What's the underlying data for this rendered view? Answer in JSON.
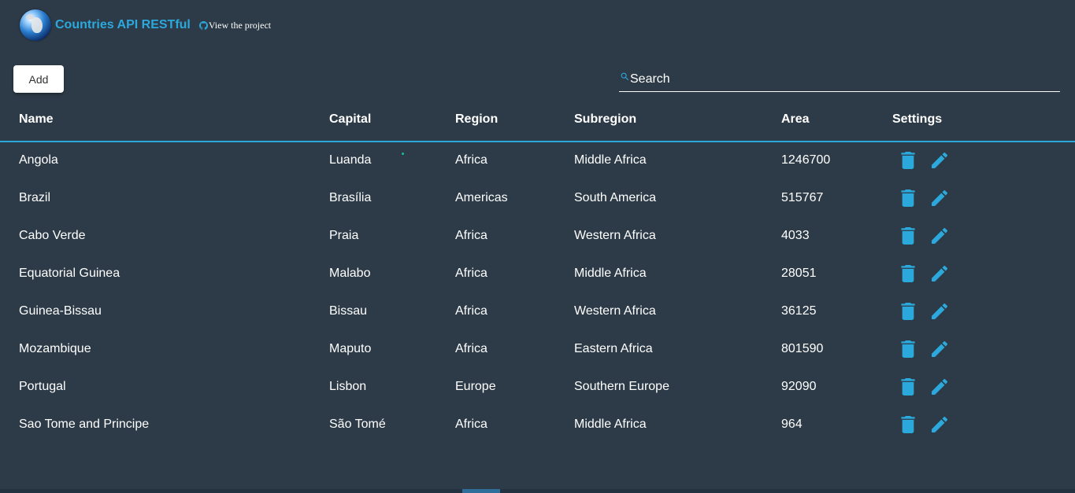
{
  "header": {
    "app_title": "Countries API RESTful",
    "project_link": "View the project",
    "logo_icon": "globe-icon",
    "project_icon": "github-icon"
  },
  "toolbar": {
    "add_label": "Add",
    "search_placeholder": "Search",
    "search_value": "",
    "search_icon": "search-icon"
  },
  "table": {
    "columns": [
      "Name",
      "Capital",
      "Region",
      "Subregion",
      "Area",
      "Settings"
    ],
    "rows": [
      {
        "name": "Angola",
        "capital": "Luanda",
        "region": "Africa",
        "subregion": "Middle Africa",
        "area": "1246700"
      },
      {
        "name": "Brazil",
        "capital": "Brasília",
        "region": "Americas",
        "subregion": "South America",
        "area": "515767"
      },
      {
        "name": "Cabo Verde",
        "capital": "Praia",
        "region": "Africa",
        "subregion": "Western Africa",
        "area": "4033"
      },
      {
        "name": "Equatorial Guinea",
        "capital": "Malabo",
        "region": "Africa",
        "subregion": "Middle Africa",
        "area": "28051"
      },
      {
        "name": "Guinea-Bissau",
        "capital": "Bissau",
        "region": "Africa",
        "subregion": "Western Africa",
        "area": "36125"
      },
      {
        "name": "Mozambique",
        "capital": "Maputo",
        "region": "Africa",
        "subregion": "Eastern Africa",
        "area": "801590"
      },
      {
        "name": "Portugal",
        "capital": "Lisbon",
        "region": "Europe",
        "subregion": "Southern Europe",
        "area": "92090"
      },
      {
        "name": "Sao Tome and Principe",
        "capital": "São Tomé",
        "region": "Africa",
        "subregion": "Middle Africa",
        "area": "964"
      }
    ],
    "row_action_icons": [
      "trash-icon",
      "pencil-icon"
    ]
  },
  "colors": {
    "background": "#2d3b48",
    "accent": "#2ba8dc",
    "text": "#ffffff"
  }
}
